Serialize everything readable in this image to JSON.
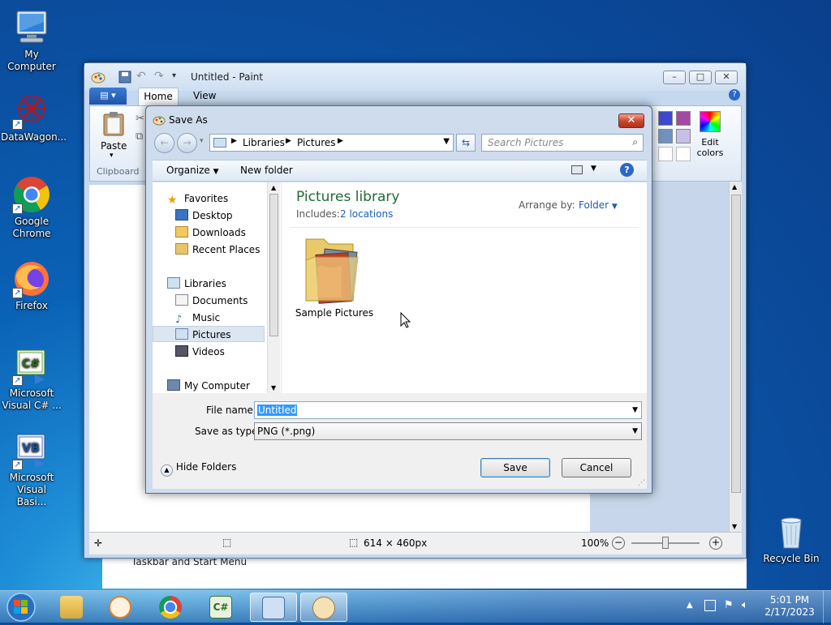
{
  "desktop": {
    "icons": [
      {
        "label": "My Computer"
      },
      {
        "label": "DataWagon..."
      },
      {
        "label": "Google Chrome"
      },
      {
        "label": "Firefox"
      },
      {
        "label": "Microsoft Visual C# ..."
      },
      {
        "label": "Microsoft Visual Basi..."
      },
      {
        "label": "Recycle Bin"
      }
    ],
    "background_text": "Taskbar and Start Menu"
  },
  "paint": {
    "title": "Untitled - Paint",
    "tabs": [
      "Home",
      "View"
    ],
    "paste_label": "Paste",
    "clipboard_label": "Clipboard",
    "edit_colors_label": "Edit colors",
    "status": {
      "size": "614 × 460px",
      "zoom": "100%"
    }
  },
  "dialog": {
    "title": "Save As",
    "breadcrumb": [
      "Libraries",
      "Pictures"
    ],
    "search_placeholder": "Search Pictures",
    "organize_label": "Organize",
    "new_folder_label": "New folder",
    "nav": {
      "favorites": "Favorites",
      "desktop": "Desktop",
      "downloads": "Downloads",
      "recent": "Recent Places",
      "libraries": "Libraries",
      "documents": "Documents",
      "music": "Music",
      "pictures": "Pictures",
      "videos": "Videos",
      "computer": "My Computer"
    },
    "library_title": "Pictures library",
    "includes_label": "Includes:",
    "includes_link": "2 locations",
    "arrange_label": "Arrange by:",
    "arrange_value": "Folder",
    "folder_item": "Sample Pictures",
    "file_name_label": "File name:",
    "file_name_value": "Untitled",
    "save_type_label": "Save as type:",
    "save_type_value": "PNG (*.png)",
    "hide_folders_label": "Hide Folders",
    "save_label": "Save",
    "cancel_label": "Cancel"
  },
  "taskbar": {
    "time": "5:01 PM",
    "date": "2/17/2023"
  },
  "colors": {
    "link": "#1a5fb4",
    "library_title": "#1e6b34",
    "selection": "#3399ff"
  }
}
